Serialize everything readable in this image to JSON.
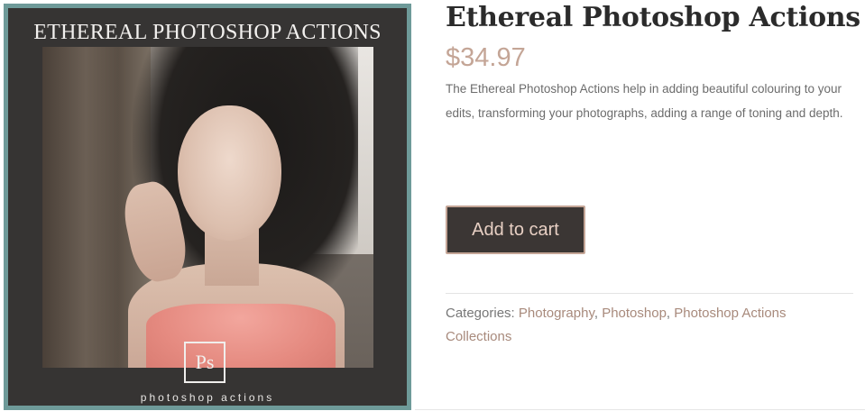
{
  "product": {
    "image": {
      "overlay_title": "ETHEREAL PHOTOSHOP ACTIONS",
      "logo_text": "Ps",
      "caption": "photoshop actions"
    },
    "title": "Ethereal Photoshop Actions",
    "price": "$34.97",
    "description": "The Ethereal Photoshop Actions help in  adding beautiful colouring to your edits, transforming your photographs, adding a range of  toning and depth.",
    "add_to_cart_label": "Add to cart",
    "categories_label": "Categories:",
    "categories": [
      "Photography",
      "Photoshop",
      "Photoshop Actions Collections"
    ]
  },
  "colors": {
    "accent": "#c4a596",
    "button_bg": "#3b3634",
    "image_border": "#6e9a99"
  }
}
